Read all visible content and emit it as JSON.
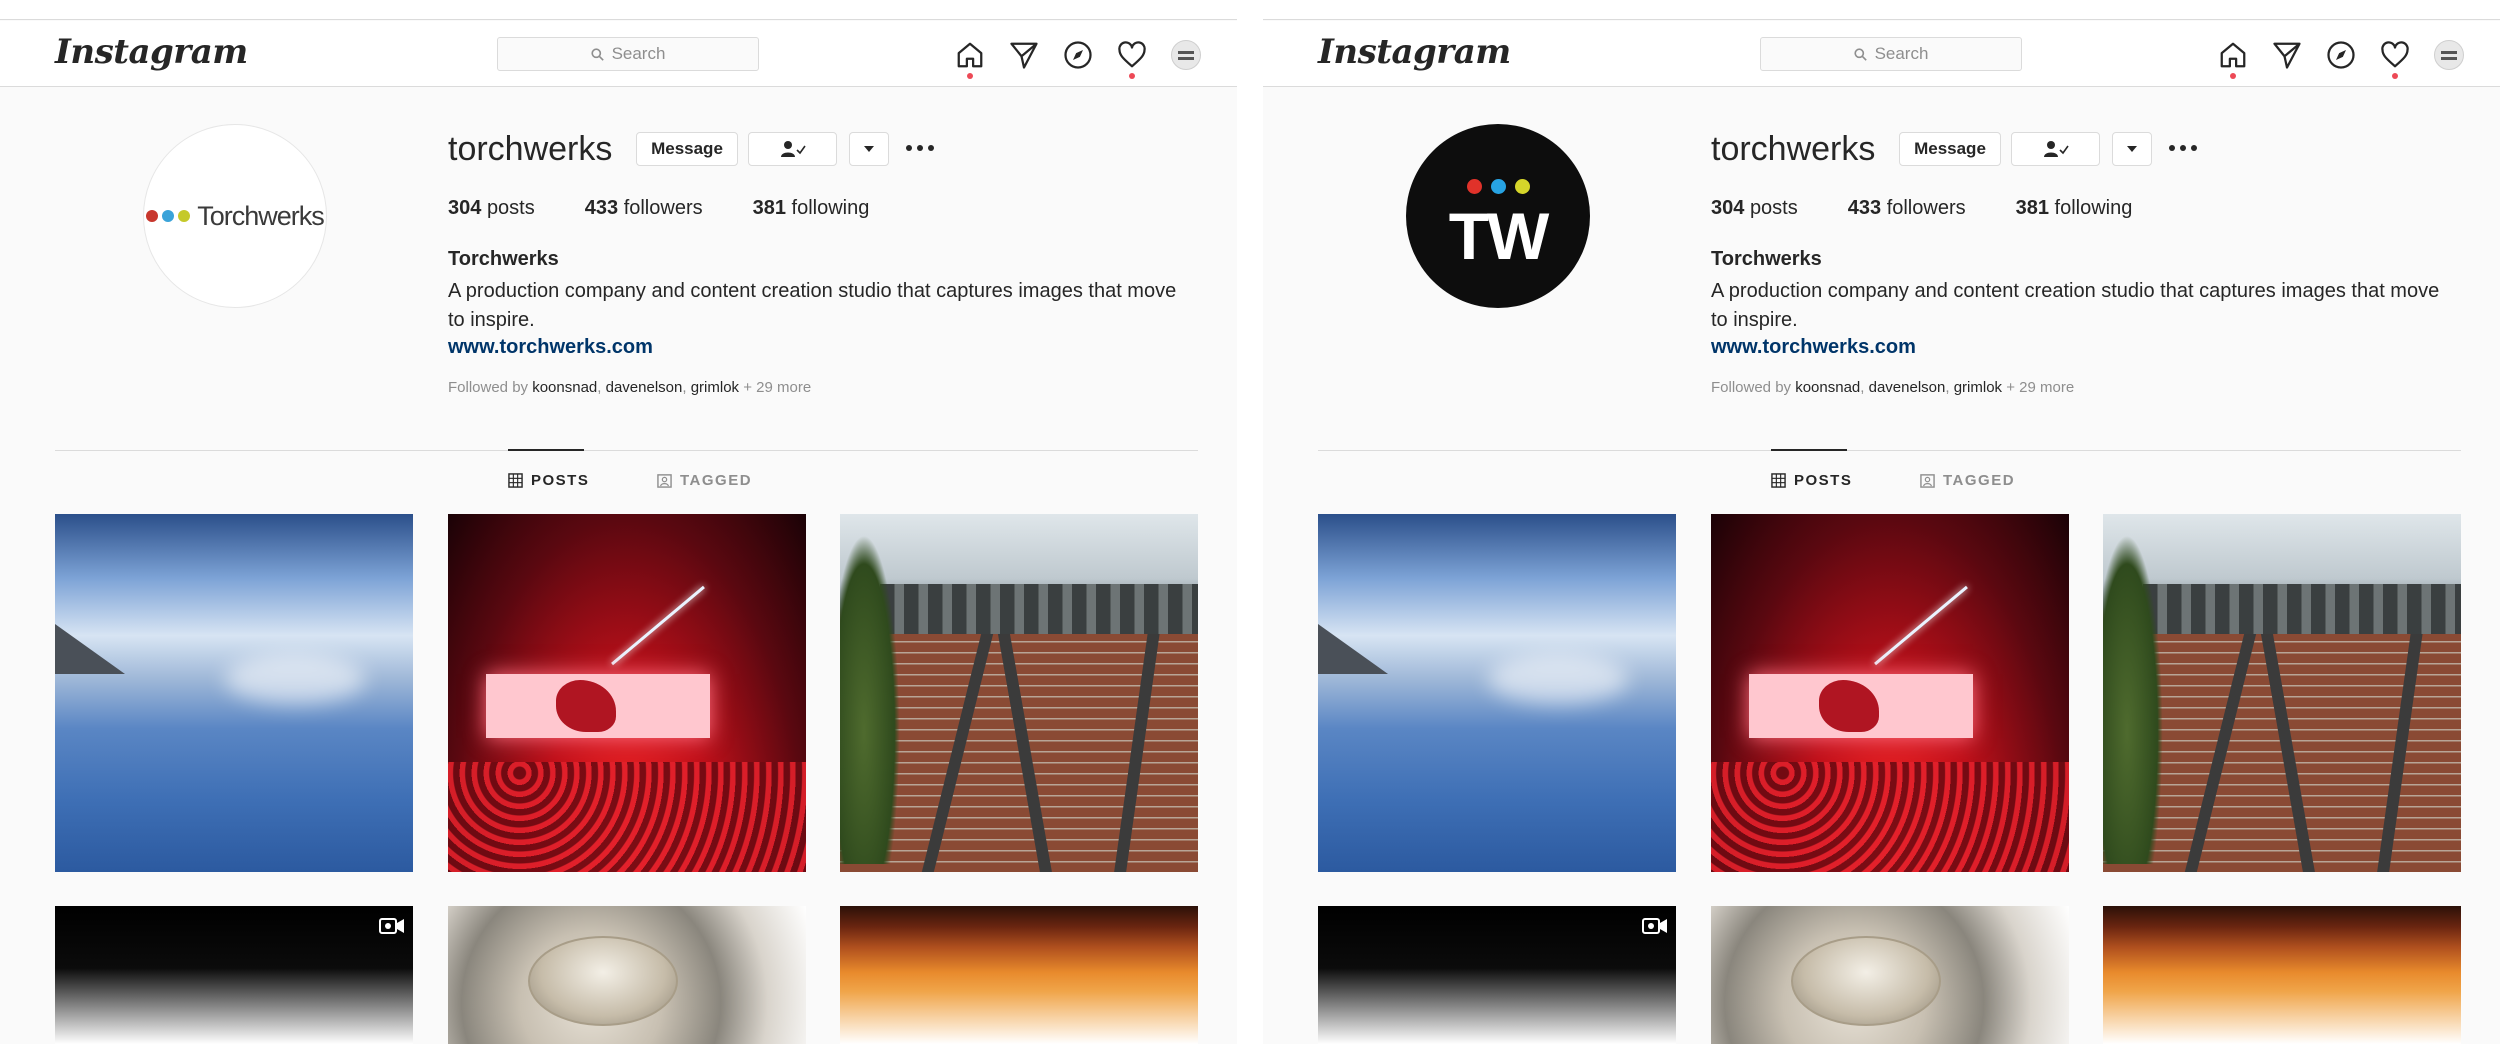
{
  "panels": [
    {
      "id": "left",
      "header": {
        "logo": "Instagram",
        "search_placeholder": "Search"
      },
      "avatar_style": "wordmark",
      "avatar_wordmark": "Torchwerks",
      "profile": {
        "username": "torchwerks",
        "message_label": "Message",
        "stats": {
          "posts": "304",
          "posts_label": "posts",
          "followers": "433",
          "followers_label": "followers",
          "following": "381",
          "following_label": "following"
        },
        "full_name": "Torchwerks",
        "bio": "A production company and content creation studio that captures images that move to inspire.",
        "website": "www.torchwerks.com",
        "followed_prefix": "Followed by ",
        "followed_users": [
          "koonsnad",
          "davenelson",
          "grimlok"
        ],
        "followed_more": "+ 29 more"
      },
      "tabs": [
        {
          "label": "POSTS",
          "active": true
        },
        {
          "label": "TAGGED",
          "active": false
        }
      ]
    },
    {
      "id": "right",
      "header": {
        "logo": "Instagram",
        "search_placeholder": "Search"
      },
      "avatar_style": "tw",
      "avatar_monogram": "TW",
      "profile": {
        "username": "torchwerks",
        "message_label": "Message",
        "stats": {
          "posts": "304",
          "posts_label": "posts",
          "followers": "433",
          "followers_label": "followers",
          "following": "381",
          "following_label": "following"
        },
        "full_name": "Torchwerks",
        "bio": "A production company and content creation studio that captures images that move to inspire.",
        "website": "www.torchwerks.com",
        "followed_prefix": "Followed by ",
        "followed_users": [
          "koonsnad",
          "davenelson",
          "grimlok"
        ],
        "followed_more": "+ 29 more"
      },
      "tabs": [
        {
          "label": "POSTS",
          "active": true
        },
        {
          "label": "TAGGED",
          "active": false
        }
      ]
    }
  ],
  "brand_colors": {
    "red": "#c8372d",
    "blue": "#3aa3d9",
    "yellow": "#c5c92a",
    "link": "#003569",
    "notification": "#ed4956"
  },
  "posts": [
    "sky-above-clouds",
    "concert-stage",
    "rooftop-crowd",
    "video-dark",
    "bottle-cap",
    "orange-texture"
  ]
}
